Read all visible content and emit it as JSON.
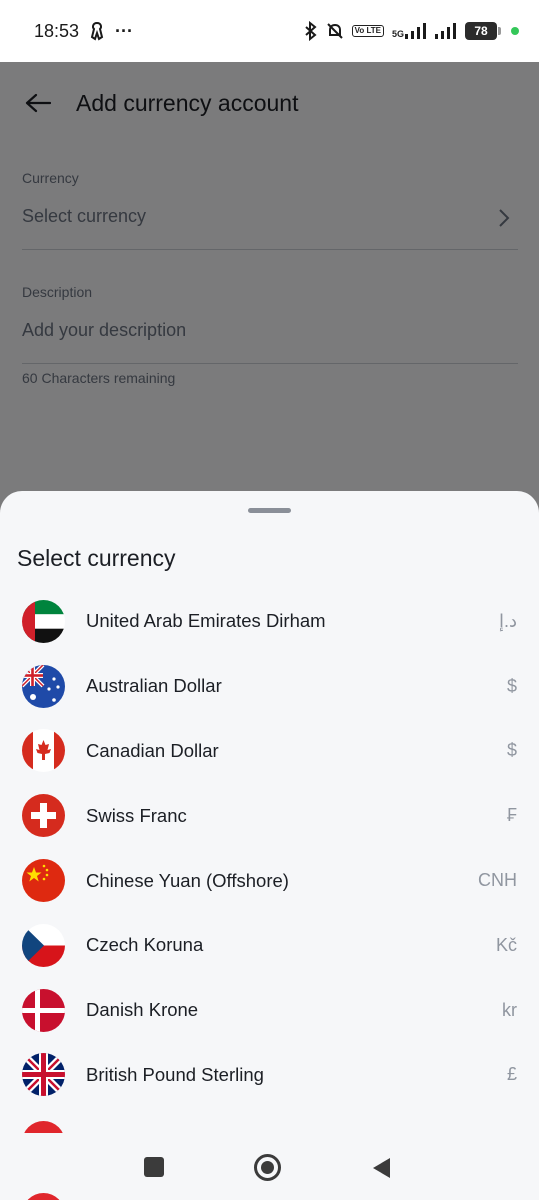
{
  "status_bar": {
    "time": "18:53",
    "more": "···",
    "volte": "Vo LTE",
    "network": "5G",
    "battery": "78"
  },
  "header": {
    "title": "Add currency account"
  },
  "form": {
    "currency_label": "Currency",
    "currency_value": "Select currency",
    "description_label": "Description",
    "description_placeholder": "Add your description",
    "chars_remaining": "60 Characters remaining"
  },
  "sheet": {
    "title": "Select currency",
    "currencies": [
      {
        "name": "United Arab Emirates Dirham",
        "symbol": "د.إ",
        "flag": "uae-flag"
      },
      {
        "name": "Australian Dollar",
        "symbol": "$",
        "flag": "australia-flag"
      },
      {
        "name": "Canadian Dollar",
        "symbol": "$",
        "flag": "canada-flag"
      },
      {
        "name": "Swiss Franc",
        "symbol": "₣",
        "flag": "switzerland-flag"
      },
      {
        "name": "Chinese Yuan (Offshore)",
        "symbol": "CNH",
        "flag": "china-flag"
      },
      {
        "name": "Czech Koruna",
        "symbol": "Kč",
        "flag": "czech-flag"
      },
      {
        "name": "Danish Krone",
        "symbol": "kr",
        "flag": "denmark-flag"
      },
      {
        "name": "British Pound Sterling",
        "symbol": "£",
        "flag": "uk-flag"
      }
    ]
  },
  "colors": {
    "background": "#f6f7f9",
    "text_primary": "#1c1f25",
    "text_secondary": "#6b7280",
    "symbol": "#9096a0"
  }
}
